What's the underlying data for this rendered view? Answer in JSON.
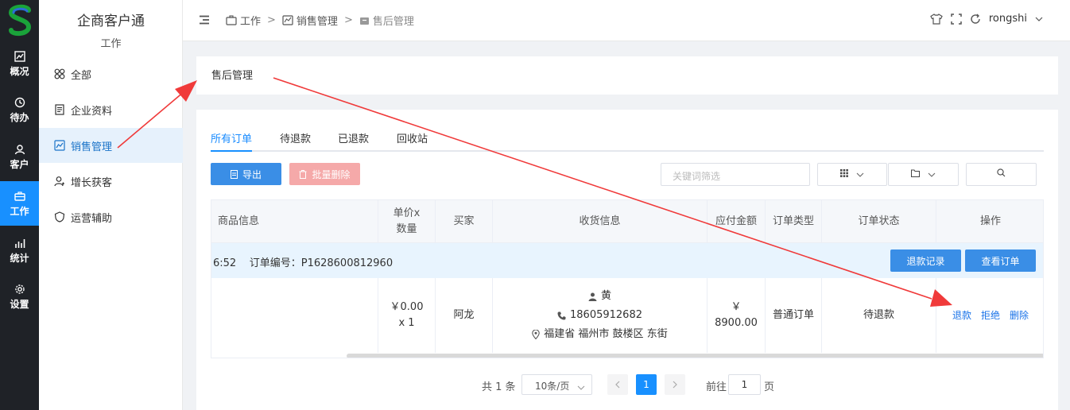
{
  "app": {
    "title": "企商客户通",
    "section": "工作"
  },
  "rail": [
    {
      "label": "概况",
      "icon": "chart-icon"
    },
    {
      "label": "待办",
      "icon": "clock-icon"
    },
    {
      "label": "客户",
      "icon": "user-icon"
    },
    {
      "label": "工作",
      "icon": "briefcase-icon",
      "active": true
    },
    {
      "label": "统计",
      "icon": "bar-chart-icon"
    },
    {
      "label": "设置",
      "icon": "gear-icon"
    }
  ],
  "sidebar": {
    "items": [
      {
        "label": "全部"
      },
      {
        "label": "企业资料"
      },
      {
        "label": "销售管理",
        "active": true
      },
      {
        "label": "增长获客"
      },
      {
        "label": "运营辅助"
      }
    ]
  },
  "header": {
    "breadcrumb": [
      "工作",
      "销售管理",
      "售后管理"
    ],
    "username": "rongshi"
  },
  "page": {
    "title": "售后管理"
  },
  "tabs": [
    {
      "label": "所有订单",
      "active": true
    },
    {
      "label": "待退款"
    },
    {
      "label": "已退款"
    },
    {
      "label": "回收站"
    }
  ],
  "toolbar": {
    "export_label": "导出",
    "bulk_delete_label": "批量删除",
    "search_placeholder": "关键词筛选"
  },
  "table": {
    "columns": [
      "商品信息",
      "单价x数量",
      "买家",
      "收货信息",
      "应付金额",
      "订单类型",
      "订单状态",
      "操作"
    ],
    "group": {
      "time_fragment": "6:52",
      "order_no": "订单编号：P1628600812960",
      "refund_record_label": "退款记录",
      "view_order_label": "查看订单"
    },
    "row": {
      "price_qty": "￥0.00 x 1",
      "buyer": "阿龙",
      "recipient": "黄",
      "phone": "18605912682",
      "address": "福建省 福州市 鼓楼区 东街",
      "amount": "￥ 8900.00",
      "order_type": "普通订单",
      "status": "待退款",
      "actions": [
        "退款",
        "拒绝",
        "删除"
      ]
    }
  },
  "pagination": {
    "total": "共 1 条",
    "page_size": "10条/页",
    "current_page": "1",
    "goto_label": "前往",
    "goto_value": "1",
    "page_suffix": "页"
  },
  "colors": {
    "accent": "#1890ff",
    "rail_bg": "#1f2227",
    "annotation": "#f03a3a"
  }
}
